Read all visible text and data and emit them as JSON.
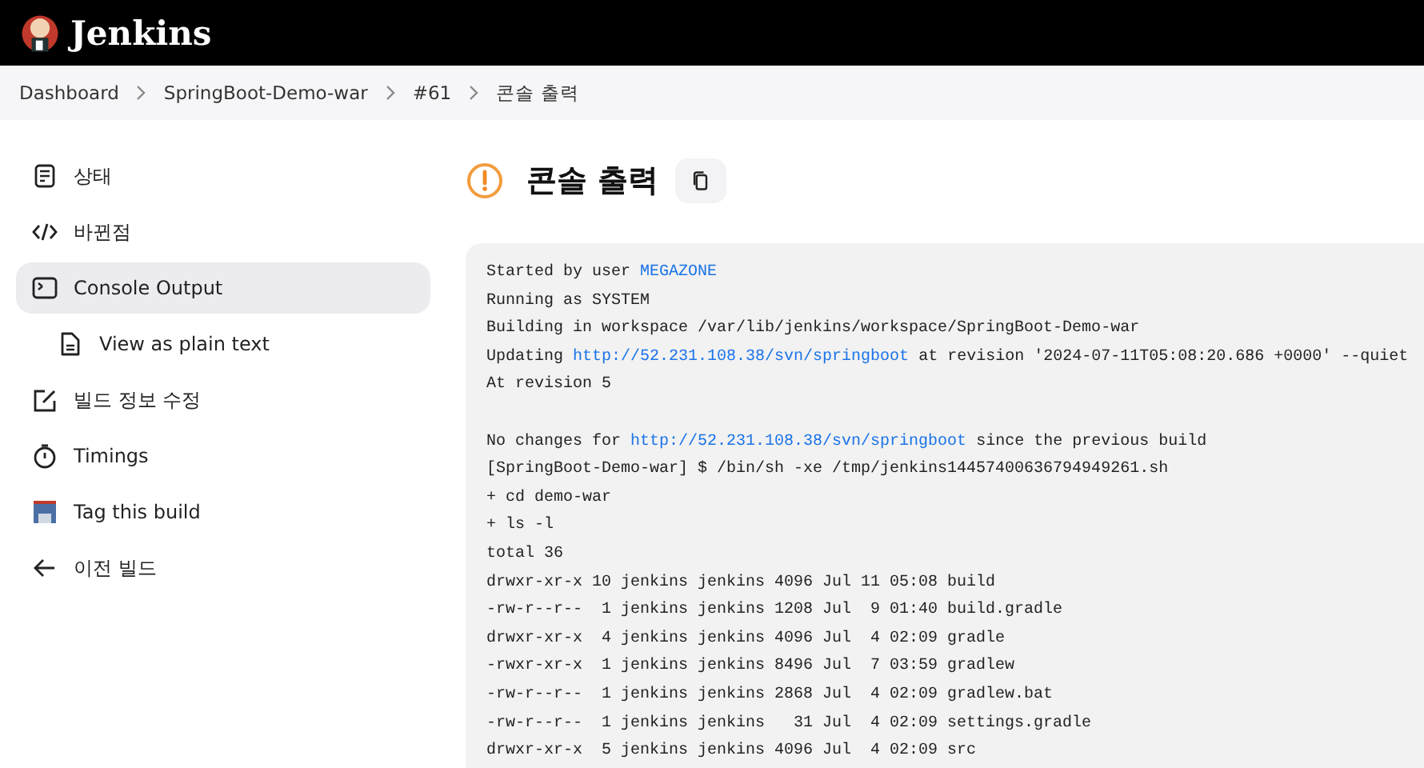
{
  "header": {
    "title": "Jenkins"
  },
  "breadcrumbs": [
    {
      "label": "Dashboard"
    },
    {
      "label": "SpringBoot-Demo-war"
    },
    {
      "label": "#61"
    },
    {
      "label": "콘솔 출력"
    }
  ],
  "sidebar": {
    "items": [
      {
        "kind": "document",
        "label": "상태",
        "selected": false
      },
      {
        "kind": "code",
        "label": "바뀐점",
        "selected": false
      },
      {
        "kind": "terminal",
        "label": "Console Output",
        "selected": true,
        "children": [
          {
            "kind": "file",
            "label": "View as plain text",
            "selected": false
          }
        ]
      },
      {
        "kind": "edit",
        "label": "빌드 정보 수정",
        "selected": false
      },
      {
        "kind": "timer",
        "label": "Timings",
        "selected": false
      },
      {
        "kind": "floppy",
        "label": "Tag this build",
        "selected": false
      },
      {
        "kind": "arrow",
        "label": "이전 빌드",
        "selected": false
      }
    ]
  },
  "main": {
    "title": "콘솔 출력",
    "console_lines": [
      {
        "parts": [
          {
            "kind": "text",
            "text": "Started by user "
          },
          {
            "kind": "link",
            "text": "MEGAZONE"
          }
        ]
      },
      {
        "parts": [
          {
            "kind": "text",
            "text": "Running as SYSTEM"
          }
        ]
      },
      {
        "parts": [
          {
            "kind": "text",
            "text": "Building in workspace /var/lib/jenkins/workspace/SpringBoot-Demo-war"
          }
        ]
      },
      {
        "parts": [
          {
            "kind": "text",
            "text": "Updating "
          },
          {
            "kind": "link",
            "text": "http://52.231.108.38/svn/springboot"
          },
          {
            "kind": "text",
            "text": " at revision '2024-07-11T05:08:20.686 +0000' --quiet"
          }
        ]
      },
      {
        "parts": [
          {
            "kind": "text",
            "text": "At revision 5"
          }
        ]
      },
      {
        "blank_before": true,
        "parts": [
          {
            "kind": "text",
            "text": "No changes for "
          },
          {
            "kind": "link",
            "text": "http://52.231.108.38/svn/springboot"
          },
          {
            "kind": "text",
            "text": " since the previous build"
          }
        ]
      },
      {
        "parts": [
          {
            "kind": "text",
            "text": "[SpringBoot-Demo-war] $ /bin/sh -xe /tmp/jenkins14457400636794949261.sh"
          }
        ]
      },
      {
        "parts": [
          {
            "kind": "text",
            "text": "+ cd demo-war"
          }
        ]
      },
      {
        "parts": [
          {
            "kind": "text",
            "text": "+ ls -l"
          }
        ]
      },
      {
        "parts": [
          {
            "kind": "text",
            "text": "total 36"
          }
        ]
      },
      {
        "parts": [
          {
            "kind": "text",
            "text": "drwxr-xr-x 10 jenkins jenkins 4096 Jul 11 05:08 build"
          }
        ]
      },
      {
        "parts": [
          {
            "kind": "text",
            "text": "-rw-r--r--  1 jenkins jenkins 1208 Jul  9 01:40 build.gradle"
          }
        ]
      },
      {
        "parts": [
          {
            "kind": "text",
            "text": "drwxr-xr-x  4 jenkins jenkins 4096 Jul  4 02:09 gradle"
          }
        ]
      },
      {
        "parts": [
          {
            "kind": "text",
            "text": "-rwxr-xr-x  1 jenkins jenkins 8496 Jul  7 03:59 gradlew"
          }
        ]
      },
      {
        "parts": [
          {
            "kind": "text",
            "text": "-rw-r--r--  1 jenkins jenkins 2868 Jul  4 02:09 gradlew.bat"
          }
        ]
      },
      {
        "parts": [
          {
            "kind": "text",
            "text": "-rw-r--r--  1 jenkins jenkins   31 Jul  4 02:09 settings.gradle"
          }
        ]
      },
      {
        "parts": [
          {
            "kind": "text",
            "text": "drwxr-xr-x  5 jenkins jenkins 4096 Jul  4 02:09 src"
          }
        ]
      }
    ]
  }
}
